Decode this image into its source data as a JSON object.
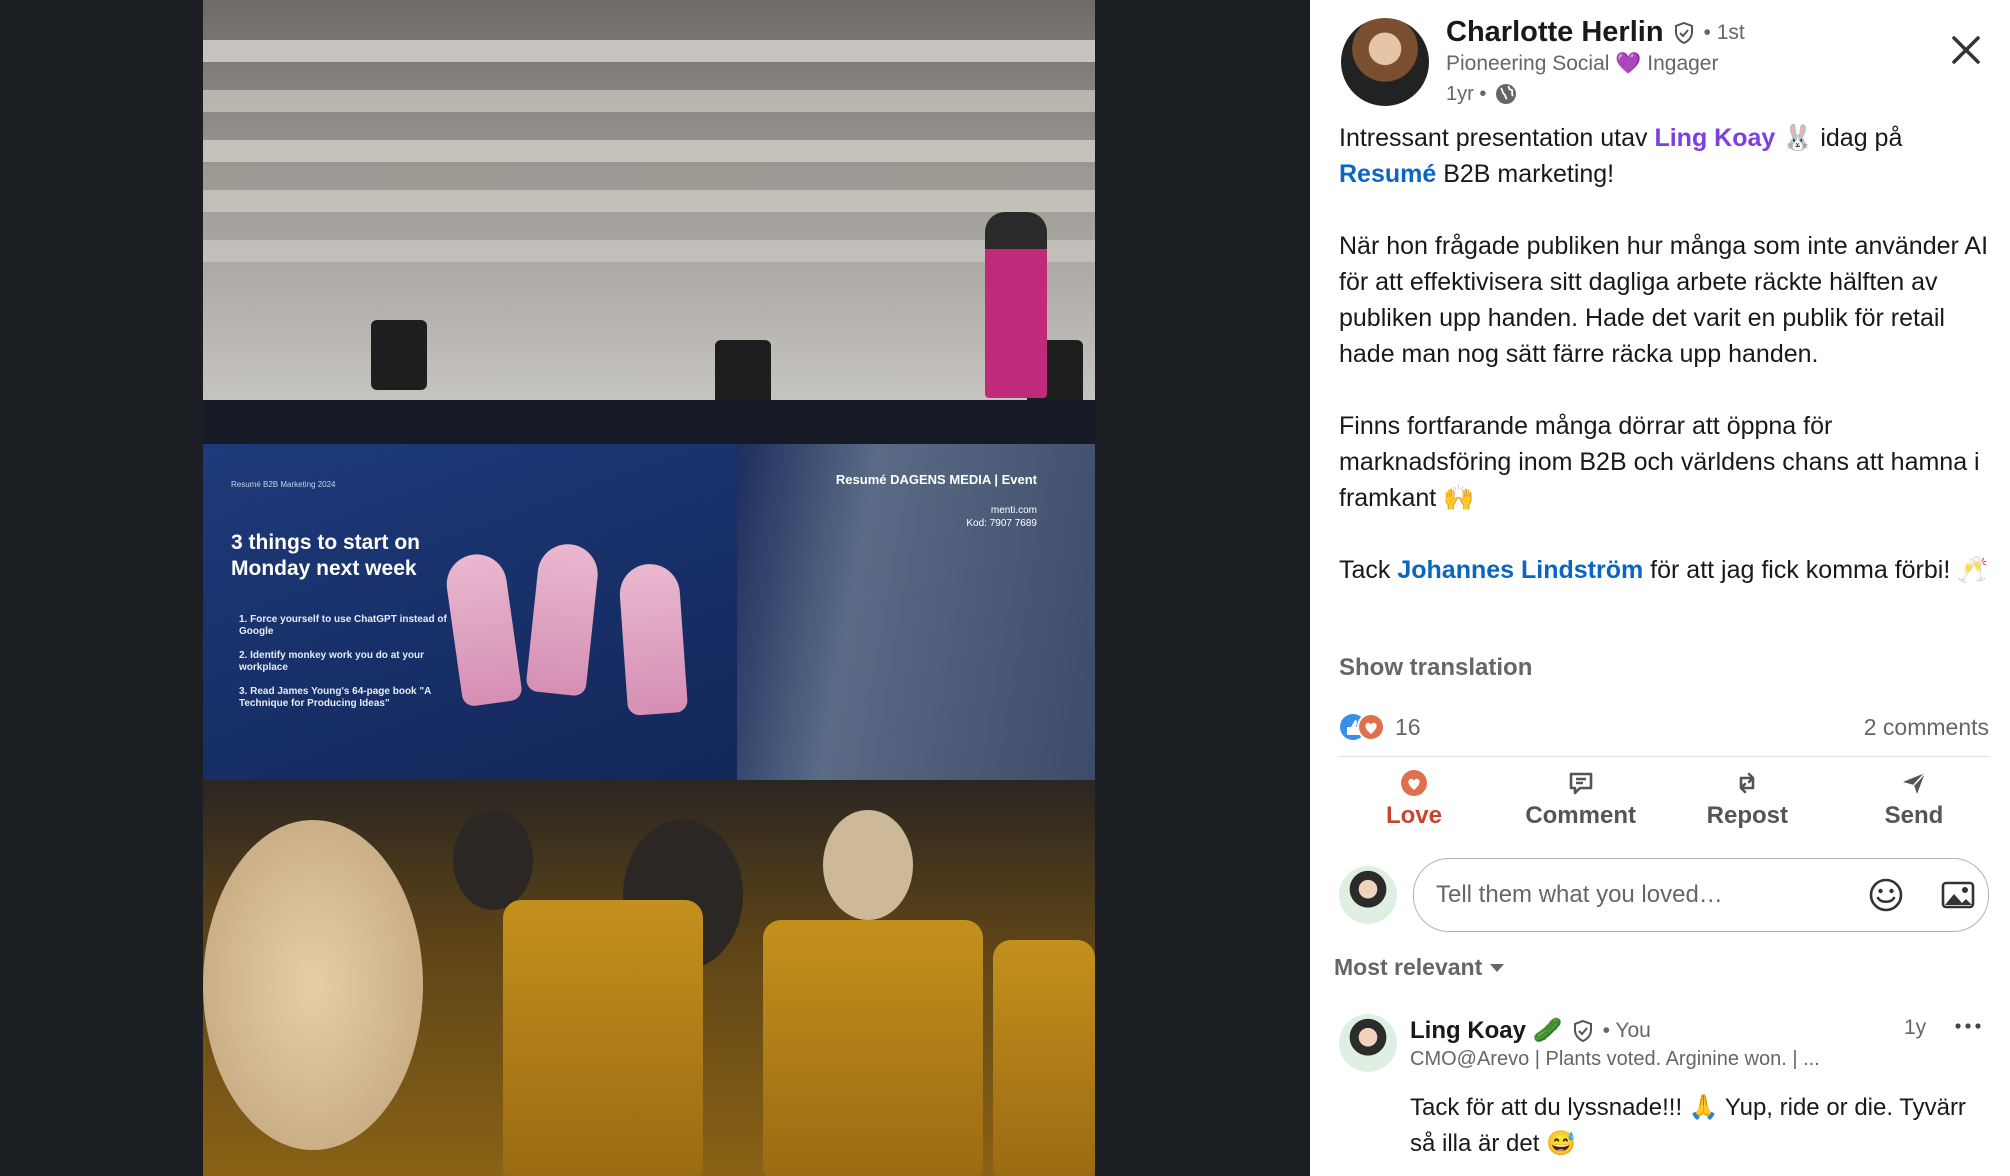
{
  "photo": {
    "slide": {
      "header": "Resumé B2B Marketing 2024",
      "title": "3 things to start on Monday next week",
      "items": [
        "1.  Force yourself to use ChatGPT instead of Google",
        "2.  Identify monkey work you do at your workplace",
        "3.  Read James Young's 64-page book \"A Technique for Producing Ideas\""
      ],
      "logos": "Resumé DAGENS MEDIA | Event",
      "menti_url": "menti.com",
      "menti_code": "Kod: 7907 7689"
    }
  },
  "post": {
    "author": {
      "name": "Charlotte Herlin",
      "degree": "• 1st",
      "headline": "Pioneering Social 💜 Ingager",
      "time": "1yr •"
    },
    "body": {
      "p1_pre": "Intressant presentation utav ",
      "p1_mention": "Ling Koay",
      "p1_mid": " 🐰 idag på ",
      "p1_link": "Resumé",
      "p1_post": " B2B marketing!",
      "p2": "När hon frågade publiken hur många som inte använder AI för att effektivisera sitt dagliga arbete räckte hälften av publiken upp handen. Hade det varit en publik för retail hade man nog sätt färre räcka upp handen.",
      "p3": "Finns fortfarande många dörrar att öppna för marknadsföring inom B2B och världens chans att hamna i framkant 🙌",
      "p4_pre": "Tack ",
      "p4_link": "Johannes Lindström",
      "p4_post": " för att jag fick komma förbi! 🥂"
    },
    "show_translation": "Show translation",
    "reactions_count": "16",
    "comments_count": "2 comments",
    "actions": {
      "love": "Love",
      "comment": "Comment",
      "repost": "Repost",
      "send": "Send"
    },
    "comment_placeholder": "Tell them what you loved…",
    "sort_label": "Most relevant"
  },
  "comment": {
    "name": "Ling Koay 🥒",
    "badge": "• You",
    "time": "1y",
    "headline": "CMO@Arevo | Plants voted. Arginine won. | ...",
    "text": "Tack för att du lyssnade!!! 🙏 Yup, ride or die. Tyvärr så illa är det 😅"
  },
  "colors": {
    "mention": "#7b3fe4",
    "link": "#0a66c2",
    "love": "#c9442c",
    "viewer_bg": "#1b1f23"
  },
  "icons": [
    "verified-shield-icon",
    "globe-icon",
    "close-icon",
    "love-icon",
    "comment-icon",
    "repost-icon",
    "send-icon",
    "emoji-icon",
    "image-icon",
    "caret-down-icon",
    "more-icon"
  ]
}
